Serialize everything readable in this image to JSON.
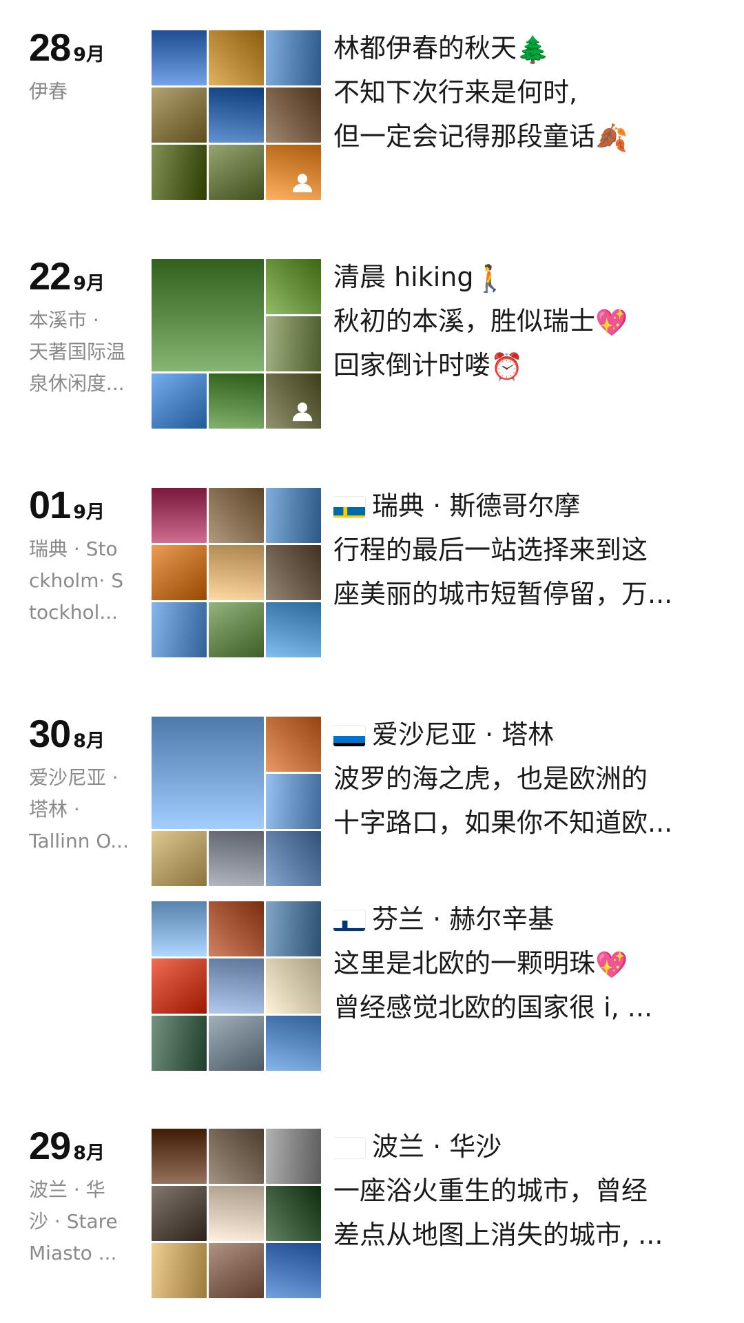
{
  "posts": [
    {
      "day": "28",
      "month": "9月",
      "location": "伊春",
      "entries": [
        {
          "lines": [
            "林都伊春的秋天",
            "不知下次行来是何时,",
            "但一定会记得那段童话"
          ],
          "emojis": [
            "🌲",
            "",
            "🍂"
          ],
          "flag": null,
          "grid_layout": "nine",
          "more_icon": "person-icon",
          "photo_colors": [
            "#4d7bbf",
            "#b88a3a",
            "#5b86b8",
            "#8b7a4a",
            "#3a6aa8",
            "#7a6048",
            "#5a6a2e",
            "#6e7d4a",
            "#d88a3a"
          ]
        }
      ]
    },
    {
      "day": "22",
      "month": "9月",
      "location": "本溪市 ·\n天著国际温\n泉休闲度...",
      "entries": [
        {
          "lines": [
            "清晨 hiking",
            "秋初的本溪，胜似瑞士",
            "回家倒计时喽"
          ],
          "emojis": [
            "🚶",
            "💖",
            "⏰"
          ],
          "flag": null,
          "grid_layout": "big",
          "more_icon": "person-icon",
          "photo_colors": [
            "#5f8d4a",
            "#6a9440",
            "#7b8a5a",
            "#4f86c6",
            "#5a8a46",
            "#6b6b48"
          ]
        }
      ]
    },
    {
      "day": "01",
      "month": "9月",
      "location": "瑞典 · Sto\nckholm· S\ntockhol...",
      "entries": [
        {
          "lines": [
            "瑞典 · 斯德哥尔摩",
            "行程的最后一站选择来到这",
            "座美丽的城市短暂停留，万..."
          ],
          "emojis": [
            "",
            "",
            ""
          ],
          "flag": "sweden",
          "grid_layout": "nine",
          "more_icon": null,
          "photo_colors": [
            "#a8466a",
            "#8a7256",
            "#5a86b4",
            "#c4762e",
            "#d8b07a",
            "#6e5e4e",
            "#5f8ec4",
            "#6c8c56",
            "#5a96c8"
          ]
        }
      ]
    },
    {
      "day": "30",
      "month": "8月",
      "location": "爱沙尼亚 ·\n塔林 ·\nTallinn O...",
      "entries": [
        {
          "lines": [
            "爱沙尼亚 · 塔林",
            "波罗的海之虎，也是欧洲的",
            "十字路口，如果你不知道欧..."
          ],
          "emojis": [
            "",
            "",
            ""
          ],
          "flag": "estonia",
          "grid_layout": "big",
          "more_icon": null,
          "photo_colors": [
            "#7aa6d8",
            "#c2703e",
            "#6e98c8",
            "#b8a06a",
            "#8a8e98",
            "#5e7ea8"
          ]
        },
        {
          "lines": [
            "芬兰 · 赫尔辛基",
            "这里是北欧的一颗明珠",
            "曾经感觉北欧的国家很 i, ..."
          ],
          "emojis": [
            "",
            "💖",
            ""
          ],
          "flag": "finland",
          "grid_layout": "nine",
          "more_icon": null,
          "photo_colors": [
            "#86b0d8",
            "#a85a3a",
            "#5a7e9e",
            "#c8462e",
            "#8aa2c6",
            "#d8ccb0",
            "#4c6a58",
            "#7a8894",
            "#5f8ec4"
          ]
        }
      ]
    },
    {
      "day": "29",
      "month": "8月",
      "location": "波兰 · 华\n沙 · Stare\nMiasto ...",
      "entries": [
        {
          "lines": [
            "波兰 · 华沙",
            "一座浴火重生的城市，曾经",
            "差点从地图上消失的城市, ..."
          ],
          "emojis": [
            "",
            "",
            ""
          ],
          "flag": "poland",
          "grid_layout": "nine",
          "more_icon": null,
          "photo_colors": [
            "#6e4a34",
            "#7a6a5a",
            "#8a8a8a",
            "#5a5048",
            "#d8c8b8",
            "#3a5a3a",
            "#c8a86a",
            "#8a6a5a",
            "#4a78b8"
          ]
        }
      ]
    }
  ]
}
